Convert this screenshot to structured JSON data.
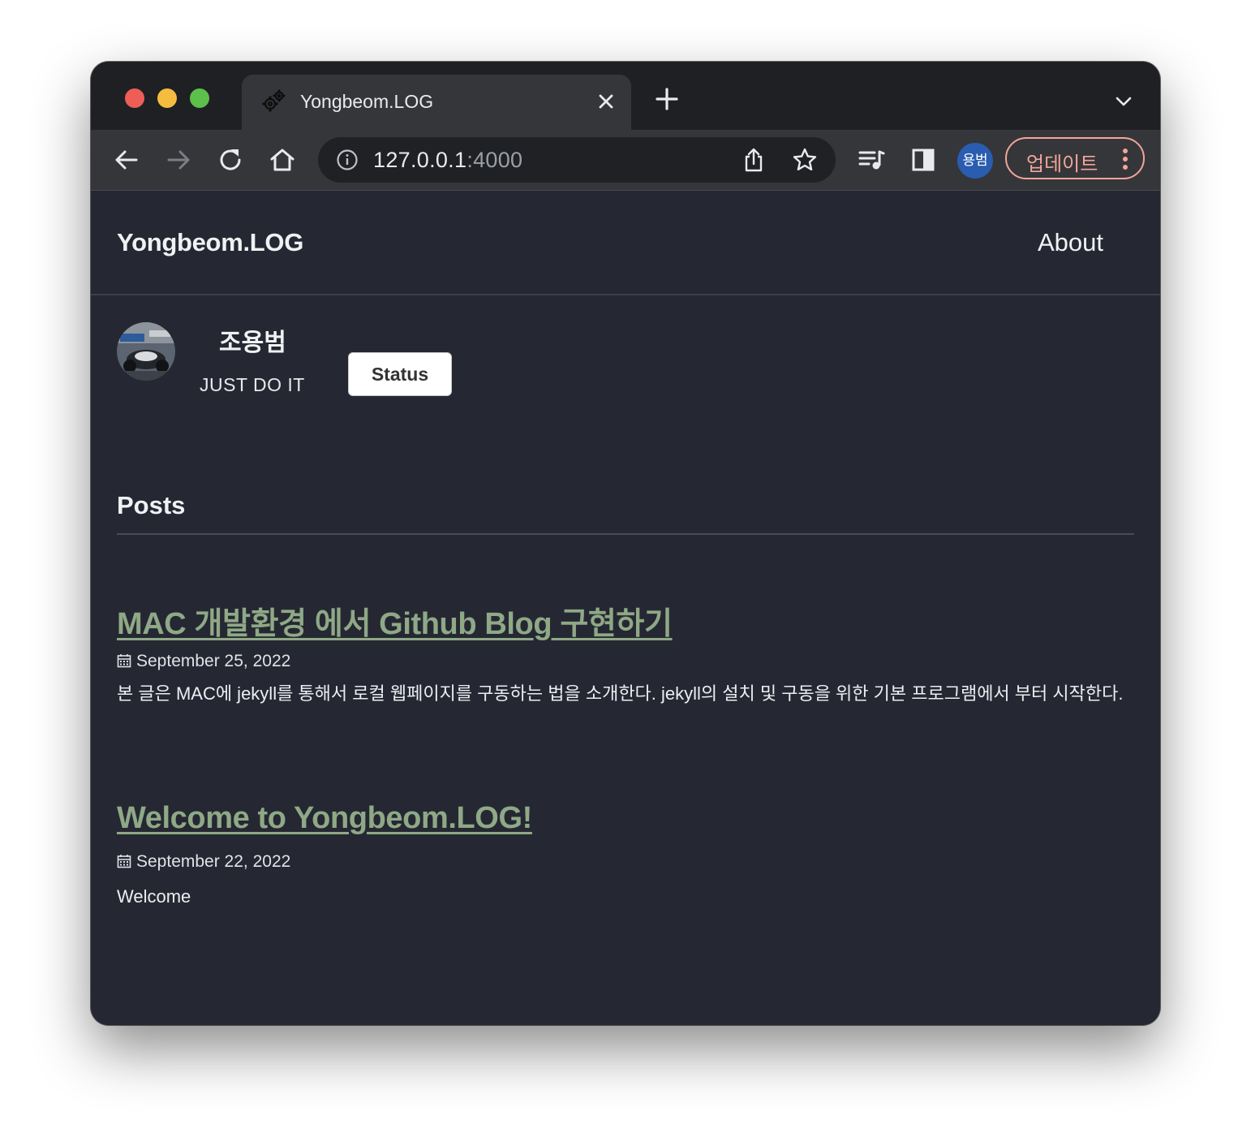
{
  "browser": {
    "tab": {
      "title": "Yongbeom.LOG",
      "favicon": "gears-icon"
    },
    "address_bar": {
      "host": "127.0.0.1",
      "port": ":4000"
    },
    "profile_initials": "용범",
    "update_button_label": "업데이트"
  },
  "site": {
    "title": "Yongbeom.LOG",
    "nav": {
      "about": "About"
    },
    "profile": {
      "name": "조용범",
      "bio": "JUST DO IT",
      "status_button": "Status"
    },
    "posts_heading": "Posts",
    "posts": [
      {
        "title": "MAC 개발환경 에서 Github Blog 구현하기",
        "date": "September 25, 2022",
        "excerpt": "본 글은 MAC에 jekyll를 통해서 로컬 웹페이지를 구동하는 법을 소개한다. jekyll의 설치 및 구동을 위한 기본 프로그램에서 부터 시작한다."
      },
      {
        "title": "Welcome to Yongbeom.LOG!",
        "date": "September 22, 2022",
        "excerpt": "Welcome"
      }
    ]
  },
  "colors": {
    "page_background": "#252833",
    "link": "#8fa886",
    "update_accent": "#f2a59a",
    "profile_badge": "#2a5db0"
  }
}
